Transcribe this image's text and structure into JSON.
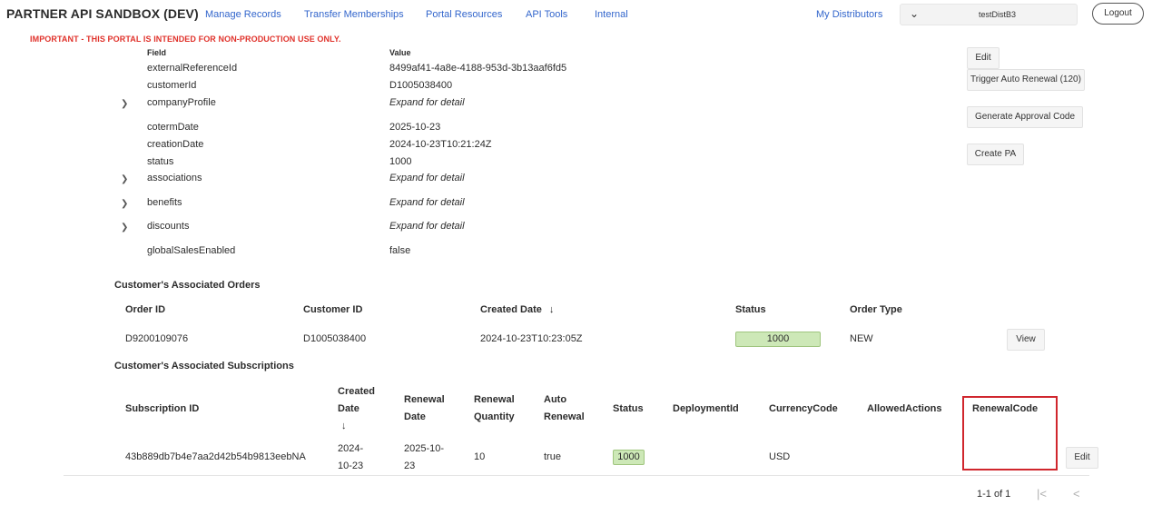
{
  "header": {
    "brand": "PARTNER API SANDBOX (DEV)",
    "nav": [
      "Manage Records",
      "Transfer Memberships",
      "Portal Resources",
      "API Tools",
      "Internal"
    ],
    "my_distributors": "My Distributors",
    "distributor_select": "testDistB3",
    "logout": "Logout",
    "warning": "IMPORTANT - THIS PORTAL IS INTENDED FOR NON-PRODUCTION USE ONLY."
  },
  "details": {
    "col_field": "Field",
    "col_value": "Value",
    "rows": [
      {
        "field": "externalReferenceId",
        "value": "8499af41-4a8e-4188-953d-3b13aaf6fd5",
        "expandable": false
      },
      {
        "field": "customerId",
        "value": "D1005038400",
        "expandable": false
      },
      {
        "field": "companyProfile",
        "value": "Expand for detail",
        "expandable": true
      },
      {
        "field": "cotermDate",
        "value": "2025-10-23",
        "expandable": false
      },
      {
        "field": "creationDate",
        "value": "2024-10-23T10:21:24Z",
        "expandable": false
      },
      {
        "field": "status",
        "value": "1000",
        "expandable": false
      },
      {
        "field": "associations",
        "value": "Expand for detail",
        "expandable": true
      },
      {
        "field": "benefits",
        "value": "Expand for detail",
        "expandable": true
      },
      {
        "field": "discounts",
        "value": "Expand for detail",
        "expandable": true
      },
      {
        "field": "globalSalesEnabled",
        "value": "false",
        "expandable": false
      }
    ]
  },
  "actions": {
    "edit": "Edit",
    "trigger_auto_renewal": "Trigger Auto Renewal (120)",
    "generate_approval_code": "Generate Approval Code",
    "create_pa": "Create PA"
  },
  "orders": {
    "title": "Customer's Associated Orders",
    "headers": {
      "order_id": "Order ID",
      "customer_id": "Customer ID",
      "created_date": "Created Date",
      "sort_icon": "↓",
      "status": "Status",
      "order_type": "Order Type"
    },
    "rows": [
      {
        "order_id": "D9200109076",
        "customer_id": "D1005038400",
        "created_date": "2024-10-23T10:23:05Z",
        "status": "1000",
        "order_type": "NEW",
        "action": "View"
      }
    ]
  },
  "subscriptions": {
    "title": "Customer's Associated Subscriptions",
    "headers": {
      "subscription_id": "Subscription ID",
      "created_date_l1": "Created",
      "created_date_l2": "Date",
      "sort_icon": "↓",
      "renewal_date_l1": "Renewal",
      "renewal_date_l2": "Date",
      "renewal_quantity_l1": "Renewal",
      "renewal_quantity_l2": "Quantity",
      "auto_renewal_l1": "Auto",
      "auto_renewal_l2": "Renewal",
      "status": "Status",
      "deployment_id": "DeploymentId",
      "currency_code": "CurrencyCode",
      "allowed_actions": "AllowedActions",
      "renewal_code": "RenewalCode"
    },
    "rows": [
      {
        "subscription_id": "43b889db7b4e7aa2d42b54b9813eebNA",
        "created_l1": "2024-",
        "created_l2": "10-23",
        "renewal_l1": "2025-10-",
        "renewal_l2": "23",
        "renewal_quantity": "10",
        "auto_renewal": "true",
        "status": "1000",
        "deployment_id": "",
        "currency_code": "USD",
        "allowed_actions": "",
        "renewal_code": "",
        "action": "Edit"
      }
    ]
  },
  "pagination": {
    "text": "1-1 of 1",
    "first_icon": "|<",
    "prev_icon": "<"
  },
  "colors": {
    "link": "#3366cc",
    "warning": "#e0322b",
    "status_fill": "#cde8b7",
    "highlight": "#d0262d"
  }
}
